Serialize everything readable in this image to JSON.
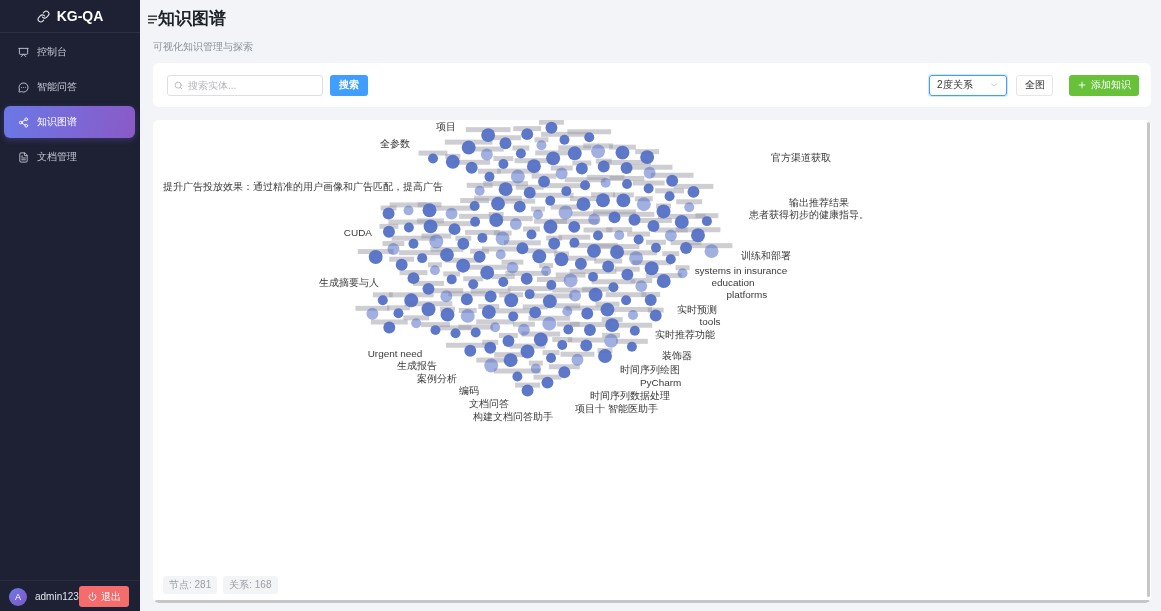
{
  "sidebar": {
    "logo": "KG-QA",
    "items": [
      {
        "label": "控制台",
        "selected": false
      },
      {
        "label": "智能问答",
        "selected": false
      },
      {
        "label": "知识图谱",
        "selected": true
      },
      {
        "label": "文档管理",
        "selected": false
      }
    ]
  },
  "user": {
    "avatar": "A",
    "name": "admin123",
    "logout": "退出"
  },
  "header": {
    "title": "知识图谱",
    "subtitle": "可视化知识管理与探索"
  },
  "toolbar": {
    "search": {
      "placeholder": "搜索实体..."
    },
    "search_button": "搜索",
    "depth_select": {
      "value": "2度关系",
      "focused": true
    },
    "full_graph_button": "全图",
    "add_button": "添加知识"
  },
  "graph": {
    "nodes": [
      {
        "label": "项目"
      },
      {
        "label": "全参数"
      },
      {
        "label": "官方渠道获取"
      },
      {
        "label": "提升广告投放效果：通过精准的用户画像和广告匹配，提高广告"
      },
      {
        "label": "输出推荐结果"
      },
      {
        "label": "患者获得初步的健康指导。"
      },
      {
        "label": "CUDA"
      },
      {
        "label": "训练和部署"
      },
      {
        "label": "systems in insurance"
      },
      {
        "label": "生成摘要与人"
      },
      {
        "label": "education"
      },
      {
        "label": "platforms"
      },
      {
        "label": "实时预测"
      },
      {
        "label": "tools"
      },
      {
        "label": "实时推荐功能"
      },
      {
        "label": "Urgent need"
      },
      {
        "label": "装饰器"
      },
      {
        "label": "生成报告"
      },
      {
        "label": "时间序列绘图"
      },
      {
        "label": "案例分析"
      },
      {
        "label": "PyCharm"
      },
      {
        "label": "编码"
      },
      {
        "label": "时间序列数据处理"
      },
      {
        "label": "文档问答"
      },
      {
        "label": "项目十 智能医助手"
      },
      {
        "label": "构建文档问答助手"
      }
    ],
    "stats": [
      "节点: 281",
      "关系: 168"
    ]
  }
}
